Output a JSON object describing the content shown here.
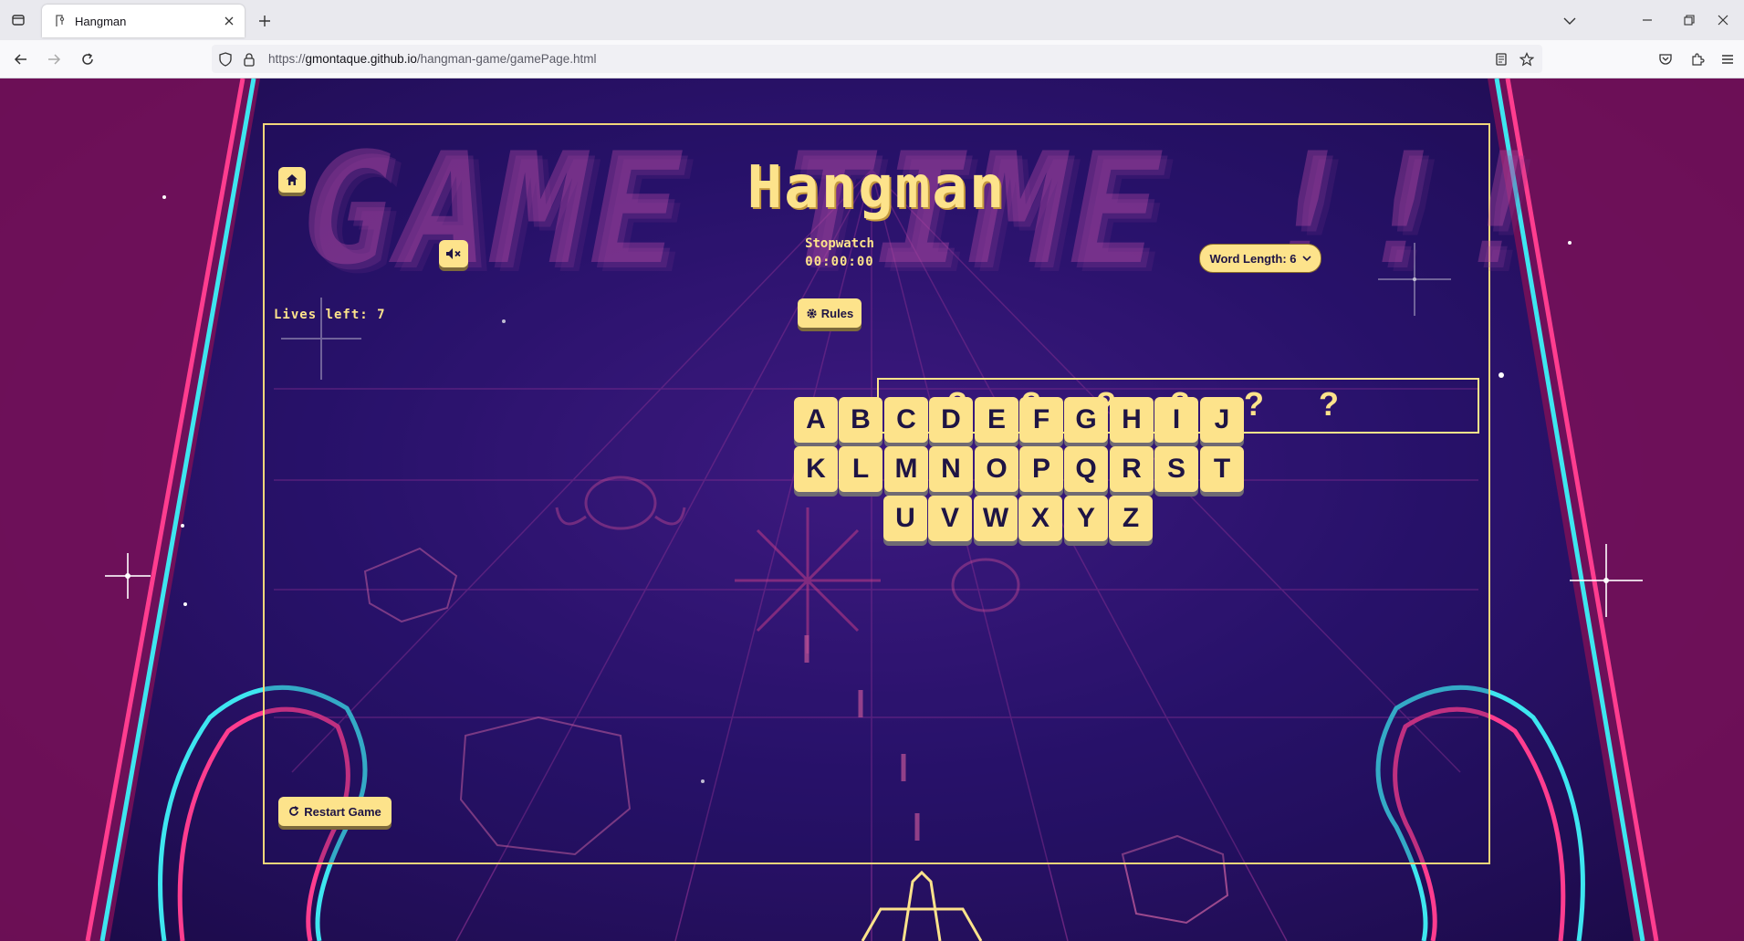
{
  "browser": {
    "tab_title": "Hangman",
    "url_scheme": "https://",
    "url_host": "gmontaque.github.io",
    "url_path": "/hangman-game/gamePage.html"
  },
  "game": {
    "background_title": "GAME TIME !!!",
    "title": "Hangman",
    "stopwatch_label": "Stopwatch",
    "stopwatch_time": "00:00:00",
    "lives_text": "Lives left: 7",
    "rules_label": "Rules",
    "word_length_label": "Word Length: 6",
    "restart_label": "Restart Game",
    "hidden_letters": [
      "?",
      "?",
      "?",
      "?",
      "?",
      "?"
    ],
    "letters": [
      "A",
      "B",
      "C",
      "D",
      "E",
      "F",
      "G",
      "H",
      "I",
      "J",
      "K",
      "L",
      "M",
      "N",
      "O",
      "P",
      "Q",
      "R",
      "S",
      "T",
      "U",
      "V",
      "W",
      "X",
      "Y",
      "Z"
    ]
  },
  "colors": {
    "accent": "#fde38b",
    "dark_text": "#1e1444",
    "neon_pink": "#ff3d8f",
    "neon_cyan": "#3ee6f0"
  },
  "icons": {
    "home": "home-icon",
    "mute": "speaker-mute-icon",
    "rules": "gear-icon",
    "restart": "restart-icon",
    "word_length_dropdown": "chevron-down-icon"
  }
}
